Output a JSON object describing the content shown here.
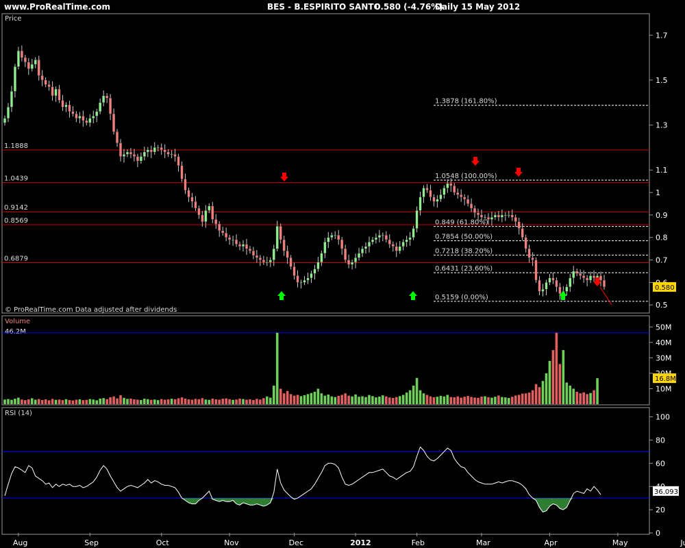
{
  "header": {
    "site": "www.ProRealTime.com",
    "instrument": "BES - B.ESPIRITO SANTO",
    "last": "0.580 (-4.76%)",
    "period": "Daily  15 May 2012"
  },
  "colors": {
    "background": "#000000",
    "up_candle": "#90EE90",
    "down_candle": "#F08080",
    "resistance_line": "#CC0000",
    "volume_up": "#6FCF5A",
    "volume_down": "#E06060",
    "rsi_line": "#FFFFFF",
    "rsi_band": "#0000FF",
    "rsi_fill": "#2E7D32",
    "price_badge": "#FFD700",
    "arrow_up": "#00FF00",
    "arrow_down": "#FF0000"
  },
  "chart_data": [
    {
      "type": "candlestick",
      "panel": "price",
      "title": "Price",
      "footnote": "© ProRealTime.com  Data adjusted after dividends",
      "ylim": [
        0.47,
        1.78
      ],
      "ytick_labels": [
        "1.7",
        "1.5",
        "1.3",
        "1.1",
        "1",
        "0.9",
        "0.8",
        "0.7",
        "0.6",
        "0.5"
      ],
      "y_ticks": [
        1.7,
        1.5,
        1.3,
        1.1,
        1.0,
        0.9,
        0.8,
        0.7,
        0.6,
        0.5
      ],
      "last_value": "0.580",
      "horizontal_levels": [
        {
          "label": "1.1888",
          "value": 1.1888
        },
        {
          "label": "1.0439",
          "value": 1.0439
        },
        {
          "label": "0.9142",
          "value": 0.9142
        },
        {
          "label": "0.8569",
          "value": 0.8569
        },
        {
          "label": "0.6879",
          "value": 0.6879
        }
      ],
      "fibonacci": [
        {
          "label": "1.3878 (161.80%)",
          "value": 1.3878
        },
        {
          "label": "1.0548 (100.00%)",
          "value": 1.0548
        },
        {
          "label": "0.849 (61.80%)",
          "value": 0.849
        },
        {
          "label": "0.7854 (50.00%)",
          "value": 0.7854
        },
        {
          "label": "0.7218 (38.20%)",
          "value": 0.7218
        },
        {
          "label": "0.6431 (23.60%)",
          "value": 0.6431
        },
        {
          "label": "0.5159 (0.00%)",
          "value": 0.5159
        }
      ],
      "x_labels": [
        "Aug",
        "Sep",
        "Oct",
        "Nov",
        "Dec",
        "2012",
        "Feb",
        "Mar",
        "Apr",
        "May",
        "Jun"
      ],
      "closes": [
        1.33,
        1.38,
        1.45,
        1.56,
        1.63,
        1.6,
        1.58,
        1.55,
        1.57,
        1.59,
        1.52,
        1.5,
        1.48,
        1.47,
        1.43,
        1.46,
        1.41,
        1.38,
        1.39,
        1.36,
        1.35,
        1.33,
        1.34,
        1.32,
        1.31,
        1.33,
        1.34,
        1.36,
        1.4,
        1.43,
        1.42,
        1.35,
        1.27,
        1.22,
        1.16,
        1.17,
        1.18,
        1.17,
        1.16,
        1.14,
        1.16,
        1.18,
        1.19,
        1.18,
        1.2,
        1.2,
        1.19,
        1.18,
        1.17,
        1.17,
        1.16,
        1.12,
        1.06,
        1.01,
        0.98,
        0.96,
        0.93,
        0.9,
        0.87,
        0.92,
        0.94,
        0.88,
        0.86,
        0.83,
        0.82,
        0.8,
        0.79,
        0.79,
        0.77,
        0.76,
        0.77,
        0.75,
        0.74,
        0.72,
        0.71,
        0.7,
        0.69,
        0.69,
        0.7,
        0.75,
        0.85,
        0.79,
        0.74,
        0.71,
        0.67,
        0.63,
        0.6,
        0.6,
        0.61,
        0.62,
        0.64,
        0.66,
        0.69,
        0.73,
        0.78,
        0.8,
        0.81,
        0.81,
        0.79,
        0.75,
        0.7,
        0.68,
        0.69,
        0.71,
        0.73,
        0.75,
        0.76,
        0.78,
        0.79,
        0.8,
        0.81,
        0.81,
        0.79,
        0.77,
        0.76,
        0.74,
        0.76,
        0.78,
        0.79,
        0.8,
        0.84,
        0.92,
        0.98,
        1.02,
        1.01,
        0.98,
        0.96,
        0.97,
        0.99,
        1.02,
        1.04,
        1.03,
        1.0,
        0.99,
        0.98,
        0.97,
        0.95,
        0.93,
        0.91,
        0.9,
        0.89,
        0.89,
        0.88,
        0.89,
        0.9,
        0.89,
        0.9,
        0.9,
        0.9,
        0.89,
        0.87,
        0.84,
        0.8,
        0.75,
        0.71,
        0.7,
        0.61,
        0.56,
        0.57,
        0.6,
        0.62,
        0.61,
        0.58,
        0.55,
        0.56,
        0.58,
        0.62,
        0.65,
        0.64,
        0.63,
        0.62,
        0.61,
        0.63,
        0.62,
        0.63,
        0.61,
        0.58
      ]
    },
    {
      "type": "bar",
      "panel": "volume",
      "title": "Volume",
      "max_label": "46.2M",
      "max_value": 46.2,
      "last_value": "16.8M",
      "ylim": [
        0,
        55
      ],
      "ytick_labels": [
        "50M",
        "40M",
        "30M",
        "20M",
        "10M"
      ],
      "y_ticks": [
        50,
        40,
        30,
        20,
        10
      ],
      "unit": "M",
      "values": [
        3.0,
        3.3,
        2.8,
        3.5,
        4.2,
        3.0,
        2.6,
        3.1,
        3.8,
        2.9,
        3.3,
        2.7,
        3.1,
        2.5,
        3.4,
        2.8,
        3.0,
        2.6,
        3.2,
        2.7,
        2.4,
        2.9,
        3.1,
        2.6,
        2.8,
        3.3,
        3.0,
        2.5,
        3.6,
        3.9,
        3.2,
        4.5,
        5.0,
        3.7,
        5.8,
        4.1,
        3.4,
        3.6,
        3.1,
        2.9,
        2.7,
        3.5,
        3.2,
        2.8,
        3.0,
        2.6,
        3.3,
        2.9,
        3.1,
        3.5,
        3.2,
        3.8,
        4.4,
        3.6,
        3.1,
        2.9,
        3.4,
        3.2,
        3.9,
        3.0,
        2.8,
        3.6,
        3.1,
        2.9,
        3.5,
        3.7,
        3.2,
        2.8,
        3.0,
        3.6,
        3.3,
        2.9,
        3.1,
        2.7,
        3.4,
        3.0,
        3.9,
        5.0,
        4.2,
        12.0,
        46.2,
        10.0,
        7.0,
        8.5,
        6.5,
        5.5,
        6.0,
        5.2,
        5.8,
        6.5,
        7.2,
        8.0,
        10.0,
        7.0,
        5.5,
        6.2,
        5.0,
        4.6,
        5.4,
        6.0,
        7.0,
        5.5,
        5.0,
        6.3,
        4.8,
        5.1,
        4.6,
        5.9,
        5.2,
        4.4,
        4.9,
        5.7,
        5.0,
        4.3,
        4.0,
        4.6,
        5.2,
        6.0,
        7.5,
        9.0,
        12.0,
        17.0,
        9.0,
        7.0,
        6.0,
        5.0,
        4.5,
        4.8,
        5.4,
        5.0,
        6.0,
        4.6,
        4.4,
        5.0,
        4.2,
        4.8,
        5.3,
        4.7,
        4.3,
        4.1,
        4.9,
        5.1,
        4.5,
        4.2,
        4.8,
        5.6,
        4.6,
        4.4,
        4.0,
        4.8,
        5.6,
        6.0,
        6.8,
        7.0,
        7.5,
        9.0,
        13.0,
        11.0,
        15.0,
        20.0,
        28.0,
        35.0,
        46.2,
        26.0,
        35.0,
        14.0,
        12.0,
        10.0,
        8.0,
        7.0,
        7.6,
        6.5,
        7.2,
        9.0,
        16.8
      ]
    },
    {
      "type": "line",
      "panel": "rsi",
      "title": "RSI (14)",
      "ylim": [
        0,
        105
      ],
      "ytick_labels": [
        "100",
        "80",
        "60",
        "40",
        "20",
        "0"
      ],
      "y_ticks": [
        100,
        80,
        60,
        40,
        20,
        0
      ],
      "last_value": "36.093",
      "bands": [
        70,
        30
      ],
      "values": [
        32,
        42,
        51,
        57,
        56,
        54,
        52,
        58,
        56,
        49,
        47,
        45,
        42,
        43,
        39,
        42,
        40,
        42,
        41,
        42,
        40,
        40,
        41,
        39,
        40,
        42,
        44,
        48,
        54,
        58,
        55,
        49,
        44,
        39,
        36,
        38,
        40,
        41,
        40,
        39,
        41,
        43,
        46,
        43,
        45,
        44,
        42,
        41,
        41,
        40,
        39,
        35,
        30,
        28,
        26,
        25,
        25,
        28,
        30,
        33,
        36,
        29,
        28,
        27,
        28,
        27,
        27,
        28,
        25,
        24,
        26,
        25,
        24,
        24,
        25,
        24,
        23,
        24,
        26,
        35,
        55,
        43,
        37,
        34,
        31,
        29,
        30,
        32,
        34,
        36,
        38,
        42,
        47,
        52,
        58,
        60,
        60,
        59,
        56,
        48,
        42,
        41,
        42,
        44,
        46,
        48,
        50,
        52,
        52,
        53,
        54,
        55,
        52,
        49,
        48,
        46,
        48,
        50,
        52,
        53,
        57,
        66,
        74,
        71,
        66,
        63,
        62,
        64,
        67,
        70,
        73,
        71,
        64,
        60,
        57,
        56,
        52,
        49,
        46,
        44,
        43,
        42,
        42,
        42,
        43,
        44,
        43,
        44,
        45,
        45,
        44,
        43,
        41,
        38,
        33,
        30,
        28,
        22,
        18,
        19,
        23,
        25,
        24,
        21,
        20,
        22,
        28,
        34,
        36,
        35,
        34,
        38,
        36,
        40,
        37,
        33
      ]
    }
  ]
}
